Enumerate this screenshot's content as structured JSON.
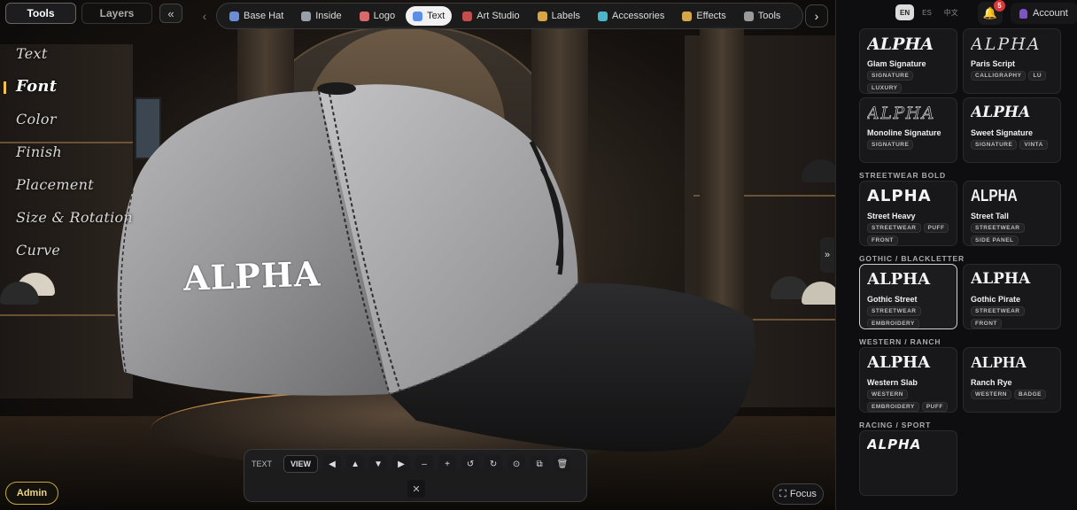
{
  "top_tabs": {
    "tools": "Tools",
    "layers": "Layers",
    "collapse": "«"
  },
  "nav": {
    "prev": "‹",
    "next": "›",
    "items": [
      {
        "label": "Base Hat",
        "icon": "cap-icon",
        "color": "#6b8cd6"
      },
      {
        "label": "Inside",
        "icon": "pen-icon",
        "color": "#9aa0aa"
      },
      {
        "label": "Logo",
        "icon": "palette-icon",
        "color": "#d86a6a"
      },
      {
        "label": "Text",
        "icon": "text-icon",
        "color": "#5b8fe6",
        "active": true
      },
      {
        "label": "Art Studio",
        "icon": "brush-icon",
        "color": "#c44d4d"
      },
      {
        "label": "Labels",
        "icon": "tag-icon",
        "color": "#d9a441"
      },
      {
        "label": "Accessories",
        "icon": "gem-icon",
        "color": "#4bb6c9"
      },
      {
        "label": "Effects",
        "icon": "sparkle-icon",
        "color": "#d6a74a"
      },
      {
        "label": "Tools",
        "icon": "wrench-icon",
        "color": "#9a9a9a"
      }
    ]
  },
  "options": [
    "Text",
    "Font",
    "Color",
    "Finish",
    "Placement",
    "Size & Rotation",
    "Curve"
  ],
  "active_option": "Font",
  "hat_text": "ALPHA",
  "admin": "Admin",
  "toolbar": {
    "label": "TEXT",
    "view": "VIEW",
    "buttons": [
      "◀",
      "▲",
      "▼",
      "▶",
      "–",
      "+",
      "↺",
      "↻",
      "⊙",
      "⧉",
      "🗑"
    ],
    "close": "✕"
  },
  "focus": "Focus",
  "expand": "»",
  "panel": {
    "langs": [
      "EN",
      "ES",
      "中文"
    ],
    "active_lang": "EN",
    "notifications": "5",
    "account": "Account",
    "sections": [
      {
        "title": "",
        "cards": [
          {
            "preview": "ALPHA",
            "style": "pv-script1",
            "name": "Glam Signature",
            "tags": [
              "SIGNATURE",
              "LUXURY"
            ]
          },
          {
            "preview": "ALPHA",
            "style": "pv-script2",
            "name": "Paris Script",
            "tags": [
              "CALLIGRAPHY",
              "LU"
            ]
          }
        ]
      },
      {
        "title": "",
        "cards": [
          {
            "preview": "ALPHA",
            "style": "pv-mono",
            "name": "Monoline Signature",
            "tags": [
              "SIGNATURE"
            ]
          },
          {
            "preview": "ALPHA",
            "style": "pv-sweet",
            "name": "Sweet Signature",
            "tags": [
              "SIGNATURE",
              "VINTA"
            ]
          }
        ]
      },
      {
        "title": "STREETWEAR BOLD",
        "cards": [
          {
            "preview": "ALPHA",
            "style": "pv-heavy",
            "name": "Street Heavy",
            "tags": [
              "STREETWEAR",
              "PUFF",
              "FRONT"
            ]
          },
          {
            "preview": "ALPHA",
            "style": "pv-tall",
            "name": "Street Tall",
            "tags": [
              "STREETWEAR",
              "SIDE PANEL"
            ]
          }
        ]
      },
      {
        "title": "GOTHIC / BLACKLETTER",
        "cards": [
          {
            "preview": "ALPHA",
            "style": "pv-gothic",
            "name": "Gothic Street",
            "tags": [
              "STREETWEAR",
              "EMBROIDERY"
            ],
            "selected": true
          },
          {
            "preview": "ALPHA",
            "style": "pv-pirate",
            "name": "Gothic Pirate",
            "tags": [
              "STREETWEAR",
              "FRONT"
            ]
          }
        ]
      },
      {
        "title": "WESTERN / RANCH",
        "cards": [
          {
            "preview": "ALPHA",
            "style": "pv-slab",
            "name": "Western Slab",
            "tags": [
              "WESTERN",
              "EMBROIDERY",
              "PUFF"
            ]
          },
          {
            "preview": "ALPHA",
            "style": "pv-rye",
            "name": "Ranch Rye",
            "tags": [
              "WESTERN",
              "BADGE"
            ]
          }
        ]
      },
      {
        "title": "RACING / SPORT",
        "cards": [
          {
            "preview": "ALPHA",
            "style": "pv-race",
            "name": "",
            "tags": []
          }
        ]
      }
    ]
  }
}
